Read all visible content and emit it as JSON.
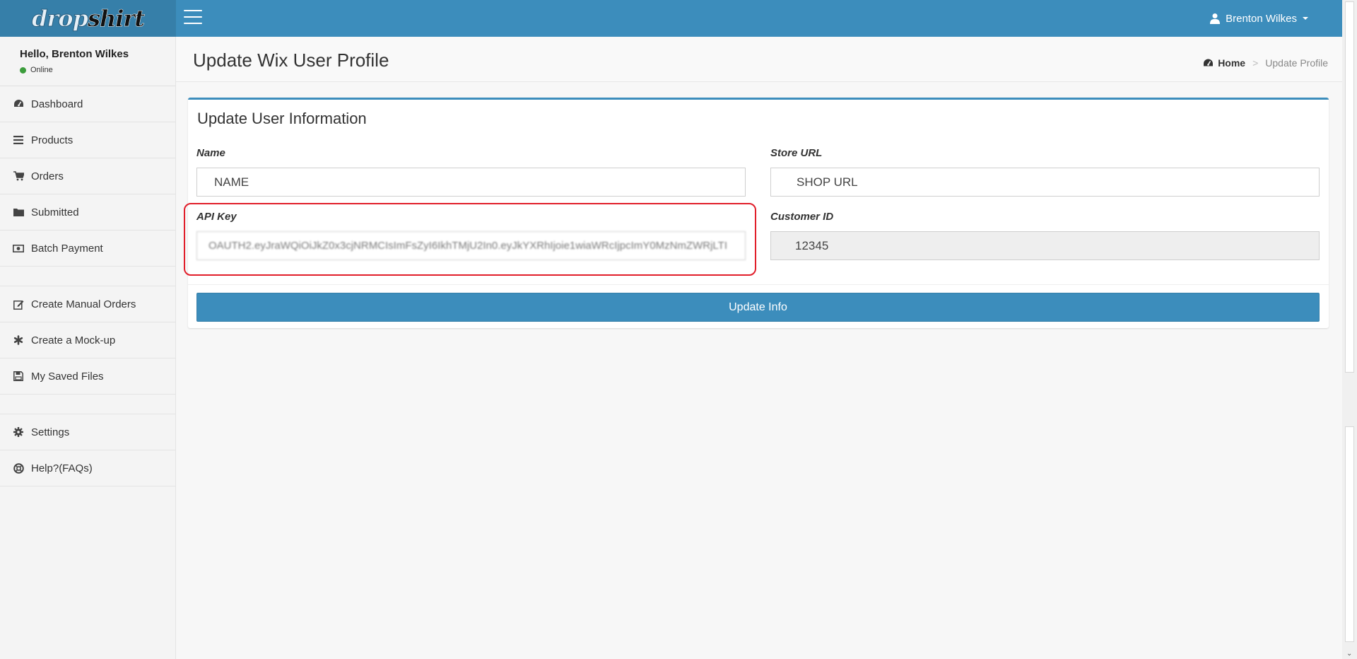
{
  "brand": {
    "logo_part1": "drop",
    "logo_part2": "shirt"
  },
  "topbar": {
    "user_name": "Brenton Wilkes"
  },
  "sidebar": {
    "greeting": "Hello, Brenton Wilkes",
    "status": "Online",
    "items": [
      {
        "label": "Dashboard",
        "icon": "dashboard-icon"
      },
      {
        "label": "Products",
        "icon": "list-icon"
      },
      {
        "label": "Orders",
        "icon": "cart-icon"
      },
      {
        "label": "Submitted",
        "icon": "folder-icon"
      },
      {
        "label": "Batch Payment",
        "icon": "money-icon"
      },
      {
        "label": "Create Manual Orders",
        "icon": "edit-icon"
      },
      {
        "label": "Create a Mock-up",
        "icon": "asterisk-icon"
      },
      {
        "label": "My Saved Files",
        "icon": "save-icon"
      },
      {
        "label": "Settings",
        "icon": "gear-icon"
      },
      {
        "label": "Help?(FAQs)",
        "icon": "lifebuoy-icon"
      }
    ]
  },
  "header": {
    "title": "Update Wix User Profile",
    "breadcrumb_home": "Home",
    "breadcrumb_current": "Update Profile"
  },
  "form": {
    "title": "Update User Information",
    "name_label": "Name",
    "name_value": "NAME",
    "store_url_label": "Store URL",
    "store_url_value": "SHOP URL",
    "api_key_label": "API Key",
    "api_key_value": "OAUTH2.eyJraWQiOiJkZ0x3cjNRMCIsImFsZyI6IkhTMjU2In0.eyJkYXRhIjoie1wiaWRcIjpcImY0MzNmZWRjLTI",
    "customer_id_label": "Customer ID",
    "customer_id_value": "12345",
    "submit_label": "Update Info"
  },
  "colors": {
    "primary": "#3c8dbc",
    "primary_dark": "#367fa9",
    "highlight": "#e11e2a",
    "online": "#3c9d3c"
  }
}
